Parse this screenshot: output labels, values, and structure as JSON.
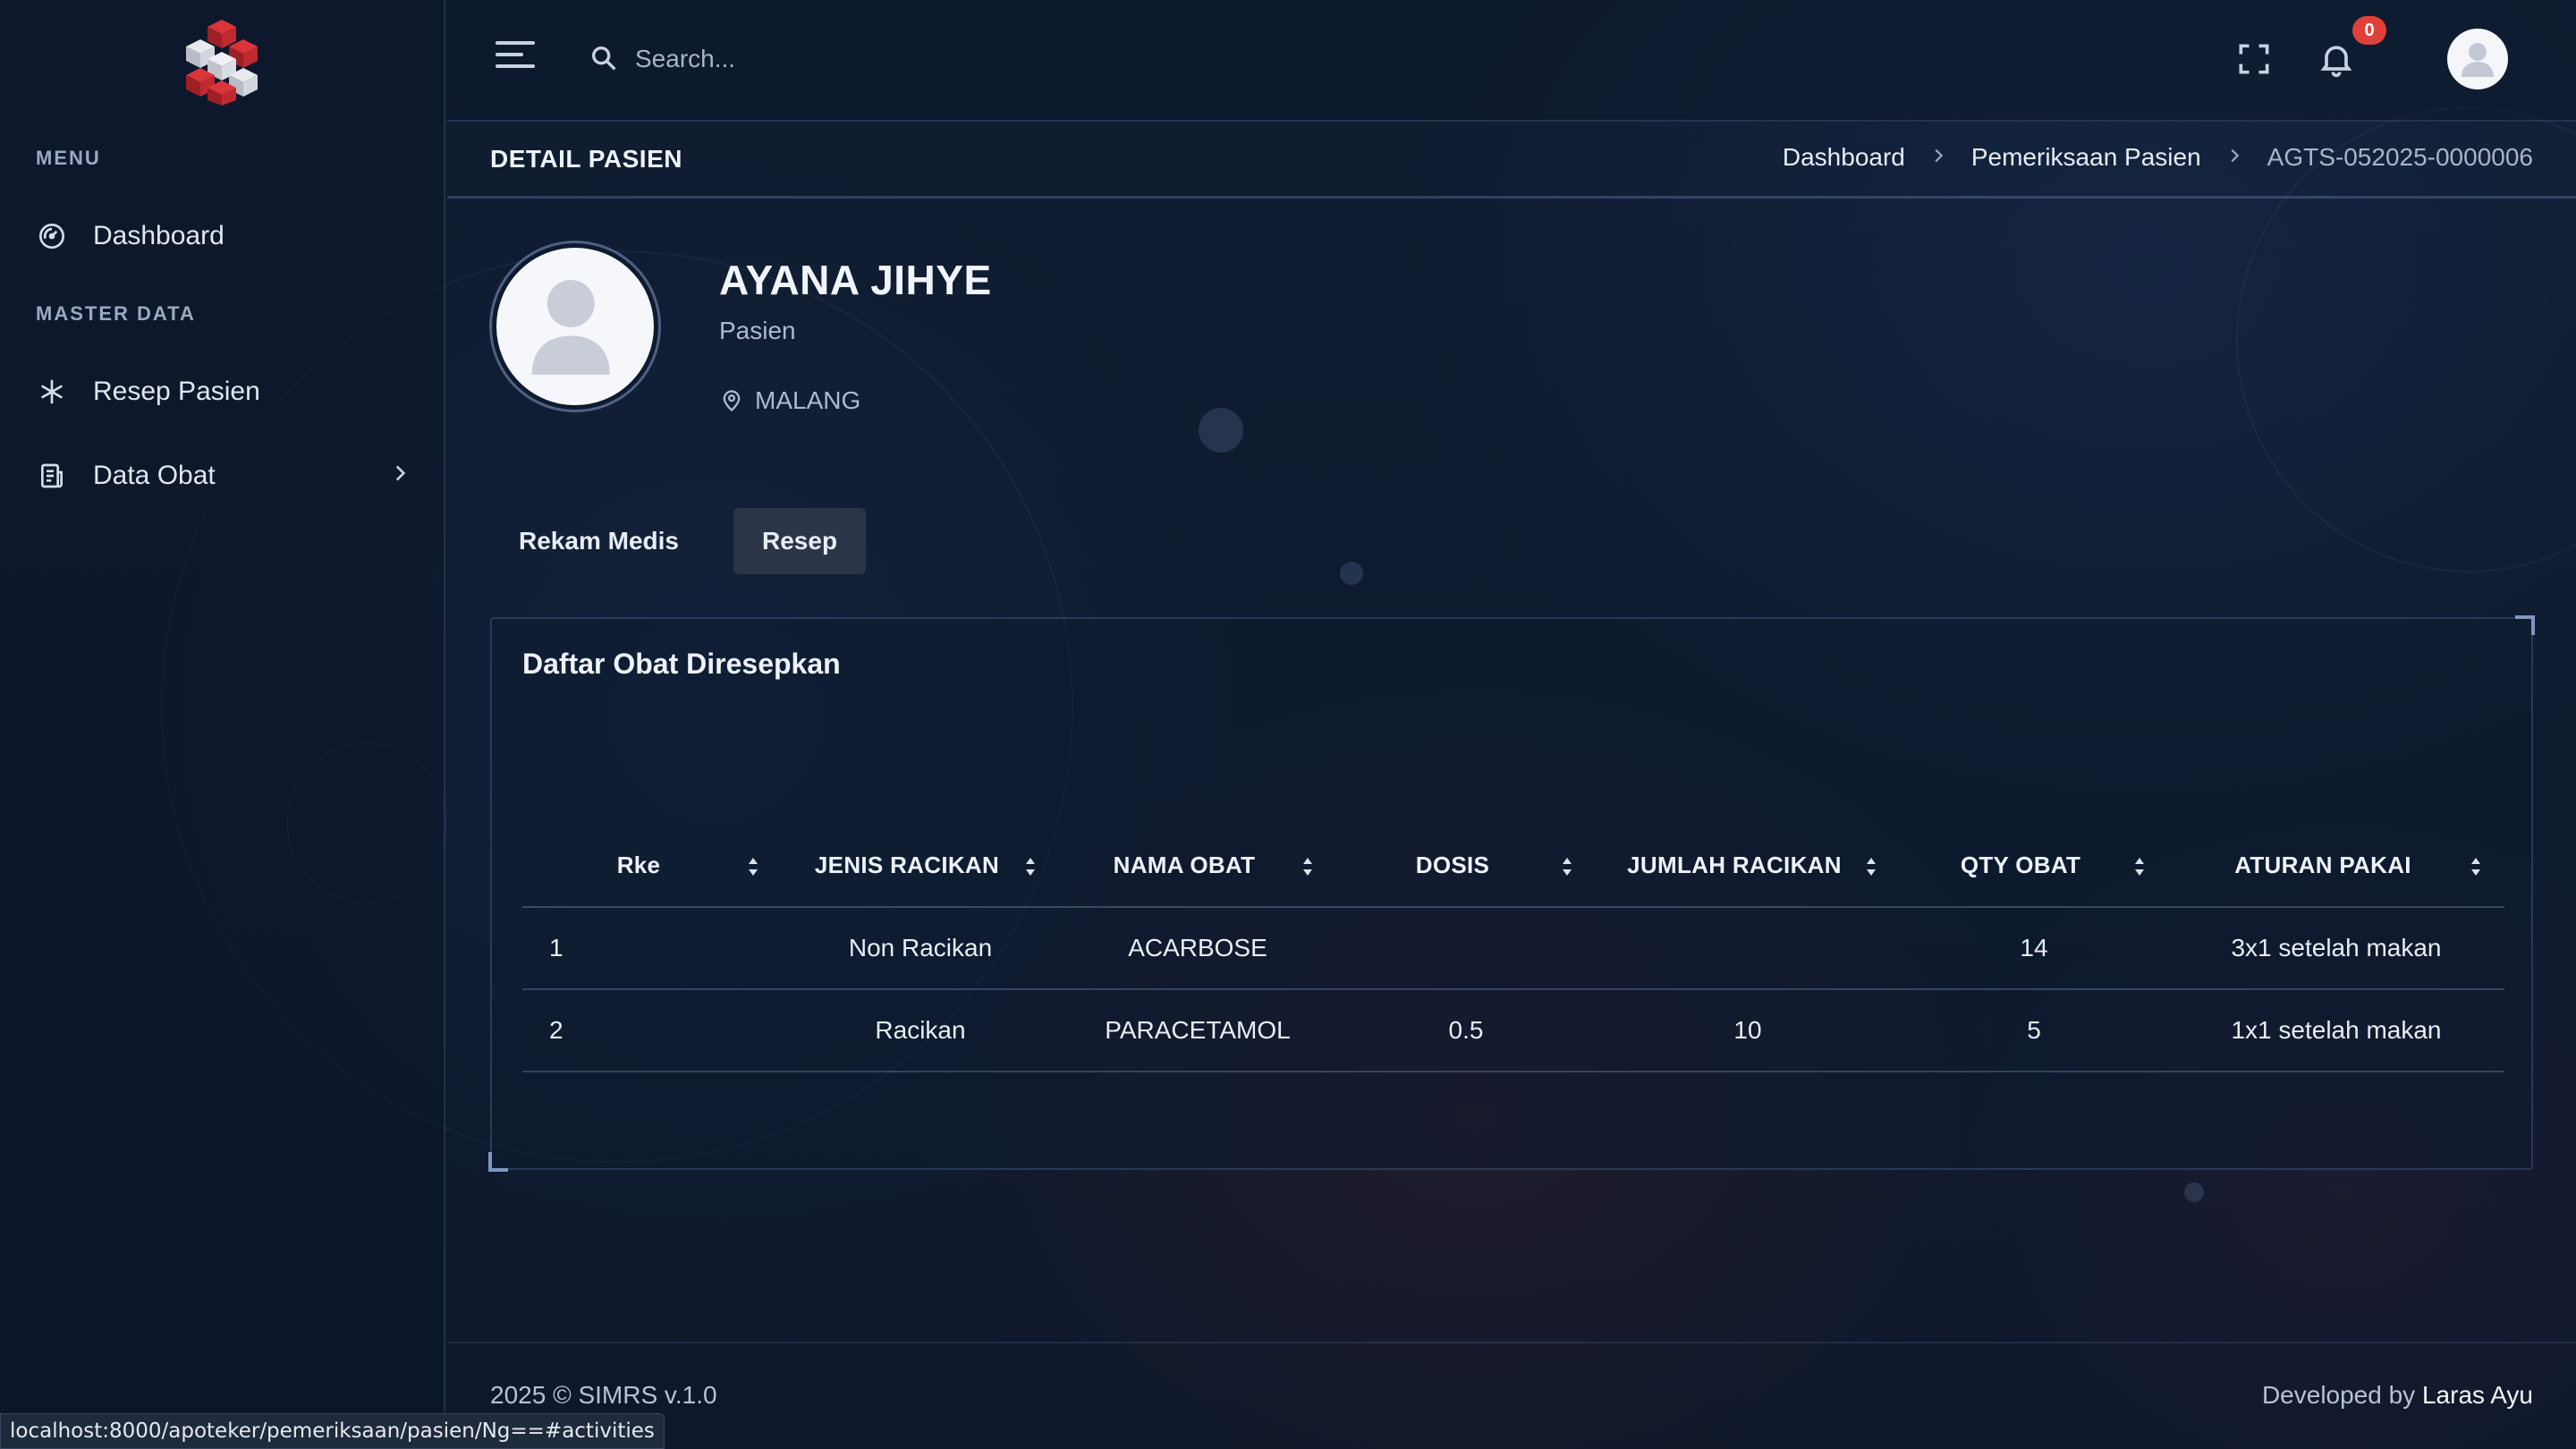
{
  "sidebar": {
    "menu_title": "MENU",
    "master_title": "MASTER DATA",
    "items": [
      {
        "label": "Dashboard",
        "icon": "dashboard-gauge-icon"
      },
      {
        "label": "Resep Pasien",
        "icon": "asterisk-icon"
      },
      {
        "label": "Data Obat",
        "icon": "document-list-icon"
      }
    ]
  },
  "header": {
    "search_placeholder": "Search...",
    "notification_count": "0"
  },
  "page": {
    "title": "DETAIL PASIEN",
    "breadcrumb": [
      "Dashboard",
      "Pemeriksaan Pasien",
      "AGTS-052025-0000006"
    ]
  },
  "patient": {
    "name": "AYANA JIHYE",
    "role": "Pasien",
    "location": "MALANG"
  },
  "tabs": [
    {
      "label": "Rekam Medis",
      "active": false
    },
    {
      "label": "Resep",
      "active": true
    }
  ],
  "prescription": {
    "title": "Daftar Obat Diresepkan",
    "columns": [
      "Rke",
      "JENIS RACIKAN",
      "NAMA OBAT",
      "DOSIS",
      "JUMLAH RACIKAN",
      "QTY OBAT",
      "ATURAN PAKAI"
    ],
    "rows": [
      [
        "1",
        "Non Racikan",
        "ACARBOSE",
        "",
        "",
        "14",
        "3x1 setelah makan"
      ],
      [
        "2",
        "Racikan",
        "PARACETAMOL",
        "0.5",
        "10",
        "5",
        "1x1 setelah makan"
      ]
    ]
  },
  "footer": {
    "copyright": "2025 © SIMRS v.1.0",
    "developed_prefix": "Developed by ",
    "author": "Laras Ayu"
  },
  "status_url": "localhost:8000/apoteker/pemeriksaan/pasien/Ng==#activities",
  "colors": {
    "background": "#0f1a2e",
    "badge": "#e0403a",
    "active_tab": "#2b3548",
    "logo_red": "#c0292f"
  }
}
